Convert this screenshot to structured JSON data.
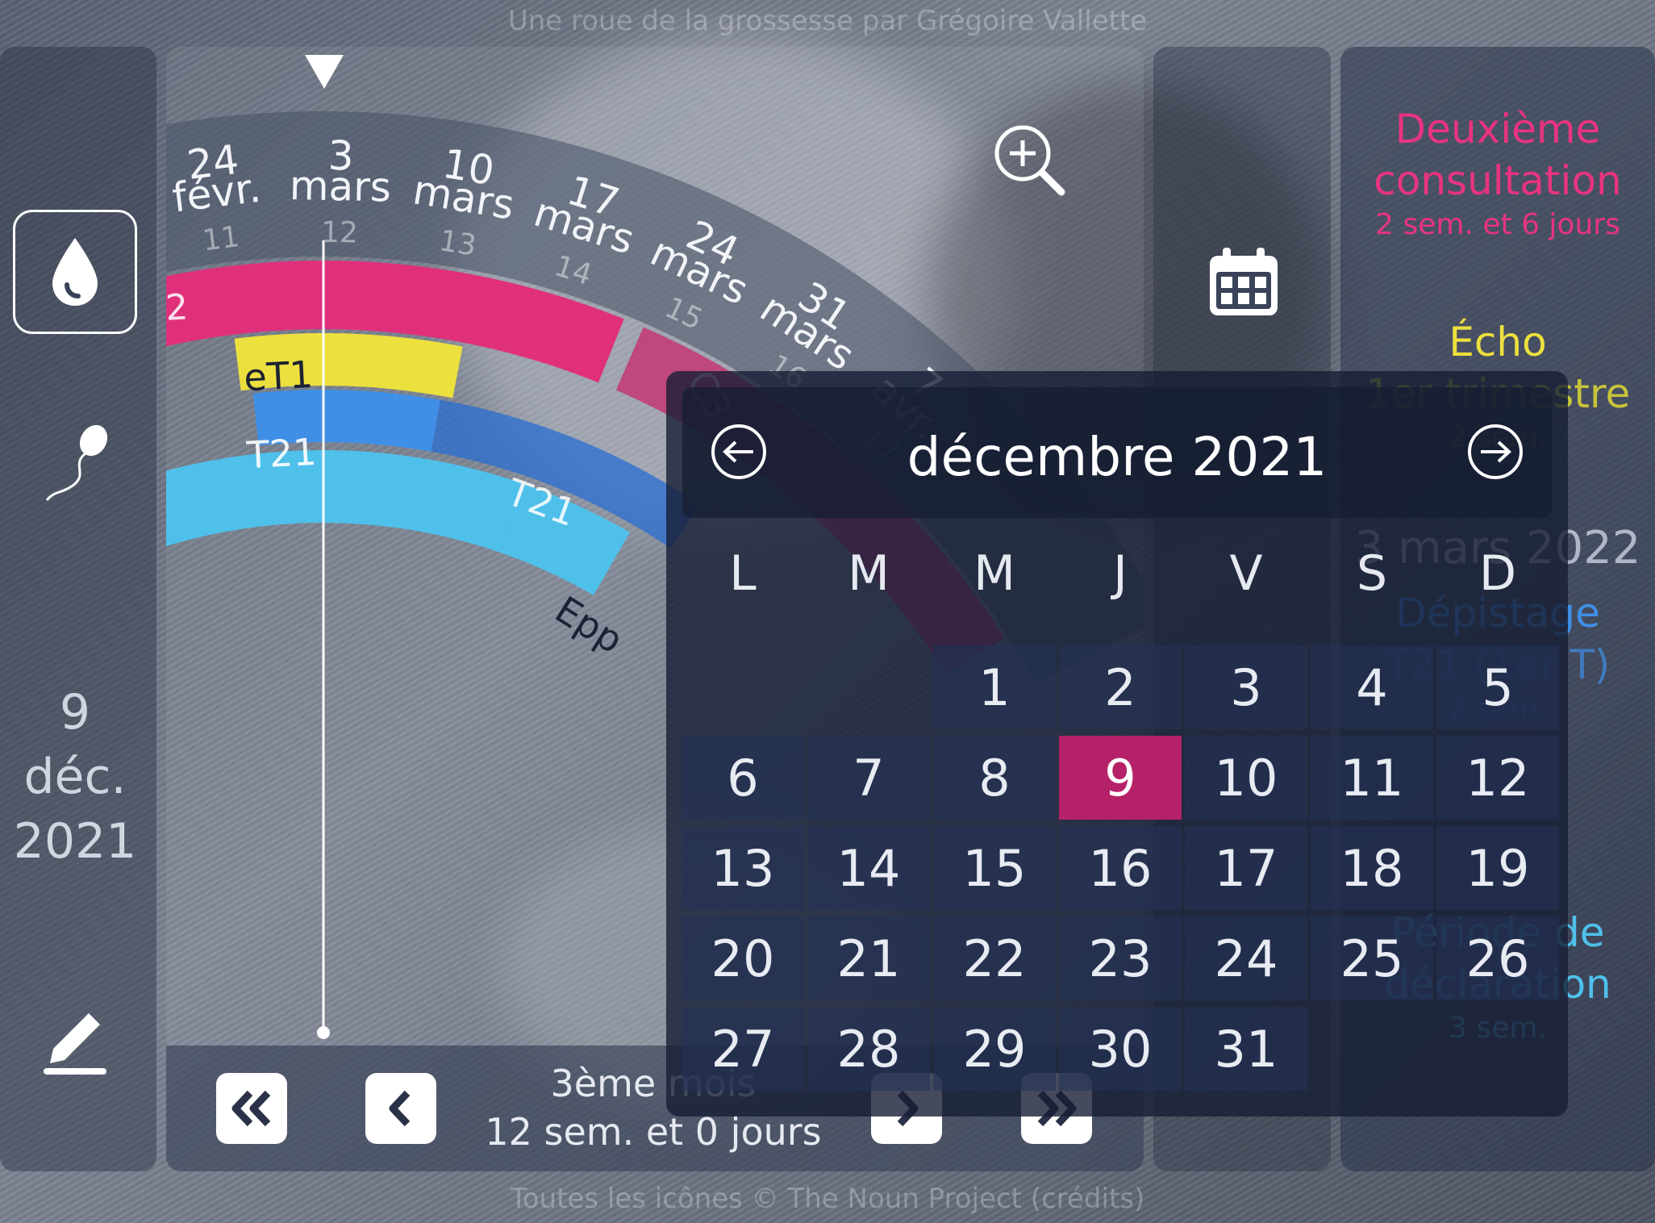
{
  "header": {
    "caption": "Une roue de la grossesse par Grégoire Vallette"
  },
  "footer": {
    "credits": "Toutes les icônes © The Noun Project (crédits)"
  },
  "sidebar": {
    "current_date": [
      "9",
      "déc.",
      "2021"
    ],
    "icons": [
      "drop-icon",
      "sperm-icon",
      "pencil-icon"
    ]
  },
  "wheel": {
    "dates": [
      {
        "day": "24",
        "month": "févr.",
        "week": "11"
      },
      {
        "day": "3",
        "month": "mars",
        "week": "12"
      },
      {
        "day": "10",
        "month": "mars",
        "week": "13"
      },
      {
        "day": "17",
        "month": "mars",
        "week": "14"
      },
      {
        "day": "24",
        "month": "mars",
        "week": "15"
      },
      {
        "day": "31",
        "month": "mars",
        "week": "16"
      },
      {
        "day": "7",
        "month": "avr.",
        "week": "17"
      }
    ],
    "bands": [
      {
        "label": "2",
        "color": "#e0307c"
      },
      {
        "label": "C3",
        "color": "#e0307c"
      },
      {
        "label": "eT1",
        "color": "#ece03e"
      },
      {
        "label": "T21",
        "color": "#3f8fe6"
      },
      {
        "label": "T21",
        "color": "#3f8fe6"
      },
      {
        "label": "Epp",
        "color": "#4fc0ea"
      }
    ]
  },
  "nav": {
    "month_label": "3ème mois",
    "elapsed": "12 sem. et 0 jours",
    "buttons": [
      "double-left",
      "left",
      "right",
      "double-right"
    ]
  },
  "right_panel": {
    "items": [
      {
        "title": "Deuxième consultation",
        "sub": "2 sem. et 6 jours",
        "color": "#e8347f"
      },
      {
        "title": "Écho",
        "sub": "",
        "color": "#ece03e"
      },
      {
        "title": "1er trimestre",
        "sub": "2 sem.",
        "color": "#c8c33a"
      },
      {
        "title": "3 mars 2022",
        "sub": "",
        "color": "#b8c0d0"
      },
      {
        "title": "Dépistage",
        "sub": "",
        "color": "#3f8fe6"
      },
      {
        "title": "T21 (1er T)",
        "sub": "2 sem.",
        "color": "#3f8fe6"
      },
      {
        "title": "Période de",
        "sub": "",
        "color": "#4fc0ea"
      },
      {
        "title": "déclaration",
        "sub": "3 sem.",
        "color": "#4fc0ea"
      }
    ]
  },
  "calendar": {
    "title": "décembre 2021",
    "weekdays": [
      "L",
      "M",
      "M",
      "J",
      "V",
      "S",
      "D"
    ],
    "first_weekday_index": 2,
    "days_in_month": 31,
    "selected_day": 9,
    "selected_color": "#b5226a"
  }
}
